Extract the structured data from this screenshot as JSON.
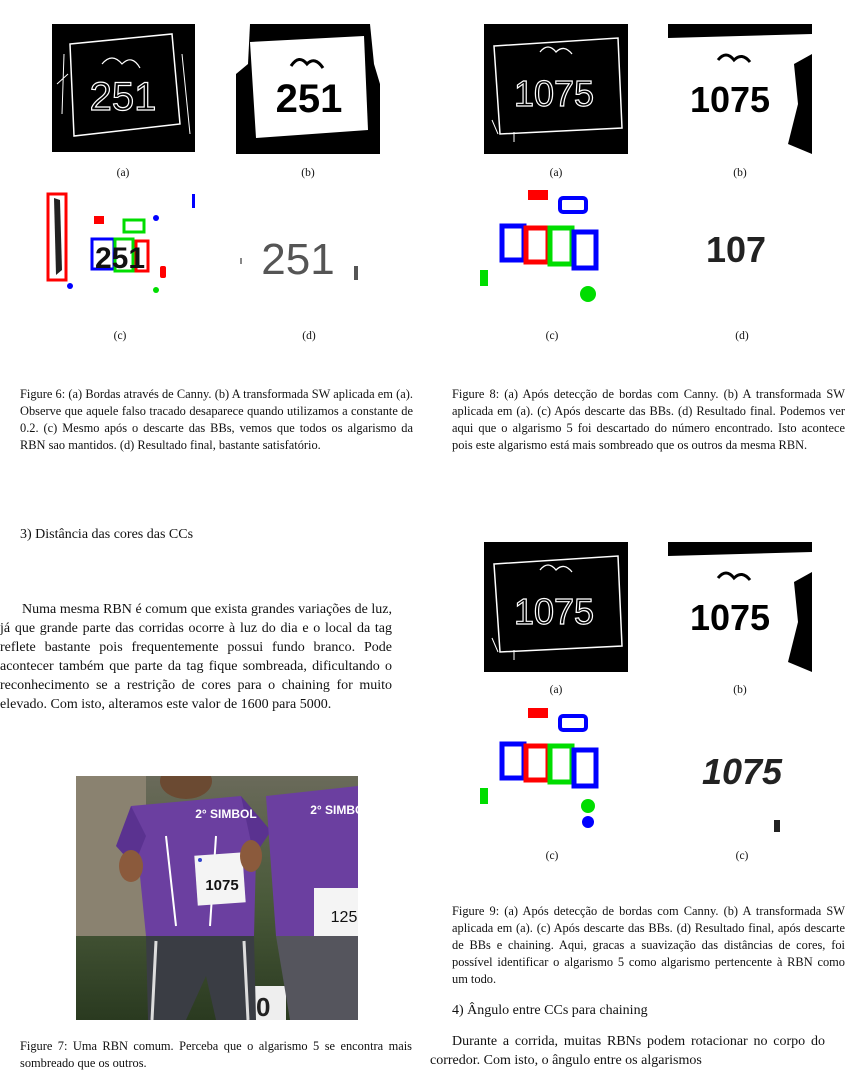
{
  "fig6": {
    "number_text": "251",
    "number_partial": "251",
    "labels": [
      "(a)",
      "(b)",
      "(c)",
      "(d)"
    ],
    "caption": "Figure 6: (a) Bordas através de Canny. (b) A transformada SW aplicada em (a). Observe que aquele falso tracado desaparece quando utilizamos a constante de 0.2. (c) Mesmo após o descarte das BBs, vemos que todos os algarismo da RBN sao mantidos. (d) Resultado final, bastante satisfatório."
  },
  "fig8": {
    "number_text": "1075",
    "number_partial": "107",
    "labels": [
      "(a)",
      "(b)",
      "(c)",
      "(d)"
    ],
    "caption": "Figure 8: (a) Após detecção de bordas com Canny. (b) A transformada SW aplicada em (a). (c) Após descarte das BBs. (d) Resultado final. Podemos ver aqui que o algarismo 5 foi descartado do número encontrado. Isto acontece pois este algarismo está mais sombreado que os outros da mesma RBN."
  },
  "fig9": {
    "number_text": "1075",
    "labels": [
      "(a)",
      "(b)",
      "(c)",
      "(c)"
    ],
    "caption": "Figure 9: (a) Após detecção de bordas com Canny. (b) A transformada SW aplicada em (a). (c) Após descarte das BBs. (d) Resultado final, após descarte de BBs e chaining. Aqui, gracas a suavização das distâncias de cores, foi possível identificar o algarismo 5 como algarismo pertencente à RBN como um todo."
  },
  "fig7": {
    "bib_left": "1075",
    "bib_right": "125",
    "shirt_text": "2° SIMBOL",
    "caption": "Figure 7: Uma RBN comum. Perceba que o algarismo 5 se encontra mais sombreado que os outros."
  },
  "section3": {
    "heading": "3) Distância das cores das CCs",
    "paragraph": "Numa mesma RBN é comum que exista grandes variações de luz, já que grande parte das corridas ocorre à luz do dia e o local da tag reflete bastante pois frequentemente possui fundo branco. Pode acontecer também que parte da tag fique sombreada, dificultando o reconhecimento se a restrição de cores para o chaining for muito elevado. Com isto, alteramos este valor de 1600 para 5000."
  },
  "section4": {
    "heading": "4) Ângulo entre CCs para chaining",
    "paragraph": "Durante a corrida, muitas RBNs podem rotacionar no corpo do corredor. Com isto, o ângulo entre os algarismos"
  },
  "colors": {
    "red": "#ff0000",
    "green": "#00dd00",
    "blue": "#0000ff",
    "purple": "#6b3fa0"
  }
}
